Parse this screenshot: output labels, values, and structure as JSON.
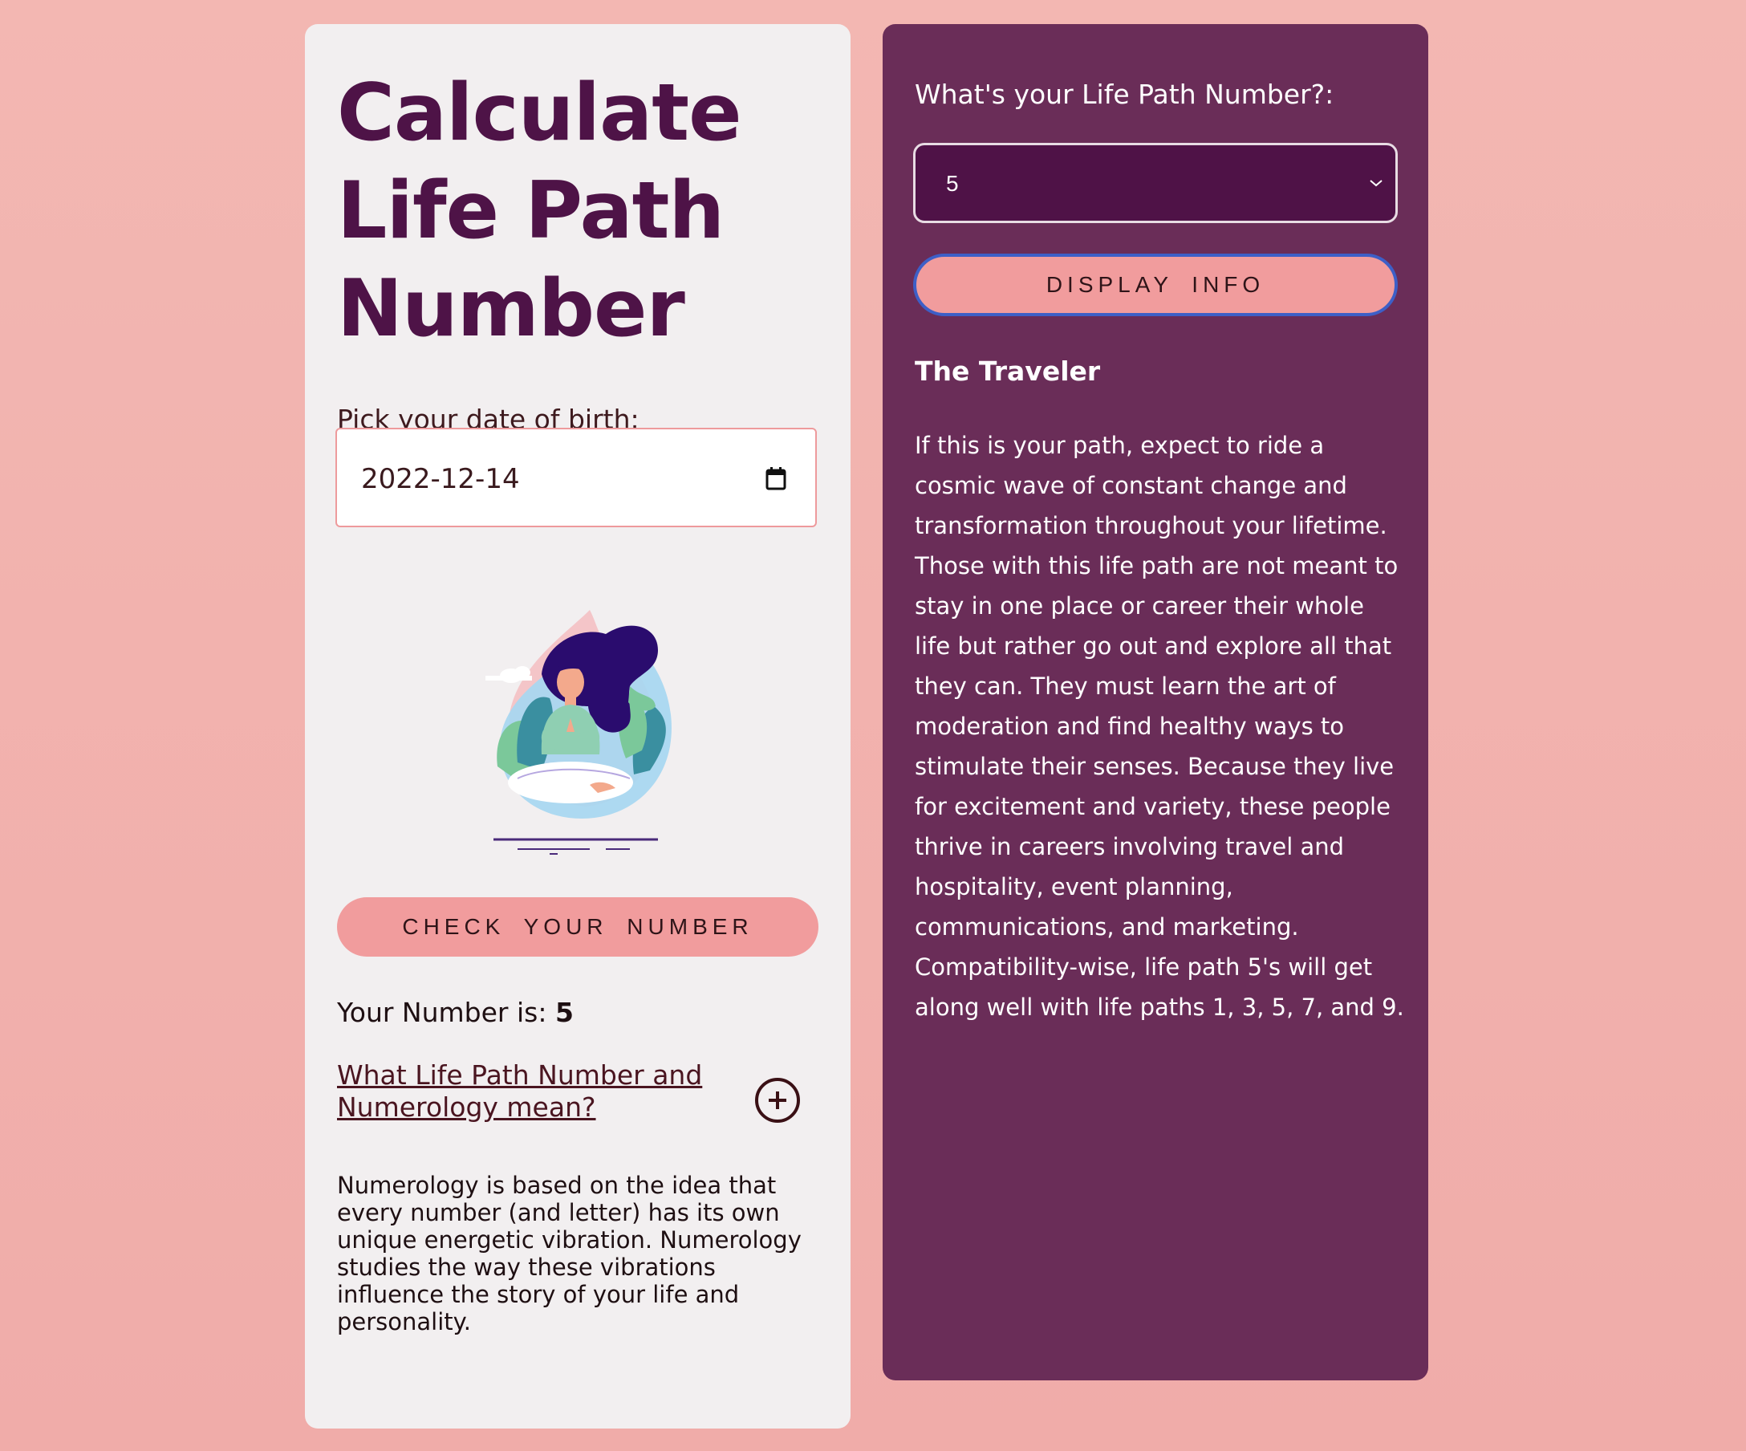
{
  "left": {
    "title": "Calculate Life Path Number",
    "dob_label": "Pick your date of birth:",
    "dob_value": "2022-12-14",
    "check_button": "CHECK YOUR NUMBER",
    "result_label": "Your Number is:",
    "result_value": "5",
    "accordion_title": "What Life Path Number and Numerology mean?",
    "accordion_text": "Numerology is based on the idea that every number (and letter) has its own unique energetic vibration. Numerology studies the way these vibrations influence the story of your life and personality."
  },
  "right": {
    "select_label": "What's your Life Path Number?:",
    "select_value": "5",
    "display_button": "DISPLAY INFO",
    "info_title": "The Traveler",
    "info_text": "If this is your path, expect to ride a cosmic wave of constant change and transformation throughout your lifetime. Those with this life path are not meant to stay in one place or career their whole life but rather go out and explore all that they can. They must learn the art of moderation and find healthy ways to stimulate their senses. Because they live for excitement and variety, these people thrive in careers involving travel and hospitality, event planning, communications, and marketing. Compatibility-wise, life path 5's will get along well with life paths 1, 3, 5, 7, and 9."
  },
  "colors": {
    "background": "#f2b3af",
    "left_card": "#f2eff0",
    "right_card": "#6a2d58",
    "title": "#4e1347",
    "button": "#f19c9d",
    "select_bg": "#4f1247"
  },
  "icons": {
    "date_picker": "calendar-icon",
    "accordion_toggle": "plus-circle-icon",
    "select_arrow": "chevron-down-icon",
    "illustration": "meditating-woman-illustration"
  }
}
